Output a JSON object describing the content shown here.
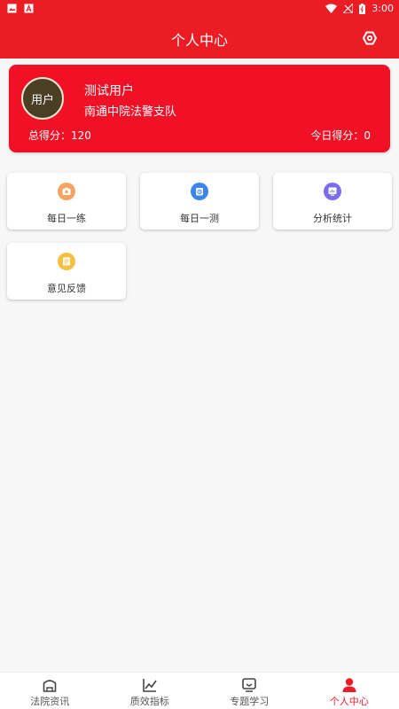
{
  "status_bar": {
    "time": "3:00"
  },
  "header": {
    "title": "个人中心"
  },
  "profile": {
    "avatar_text": "用户",
    "name": "测试用户",
    "department": "南通中院法警支队",
    "total_score": "总得分：120",
    "today_score": "今日得分：0"
  },
  "functions": [
    {
      "label": "每日一练",
      "icon": "camera-icon",
      "color": "#f5a463"
    },
    {
      "label": "每日一测",
      "icon": "alarm-icon",
      "color": "#3b86e8"
    },
    {
      "label": "分析统计",
      "icon": "monitor-icon",
      "color": "#7b6cea"
    },
    {
      "label": "意见反馈",
      "icon": "feedback-icon",
      "color": "#f7c140"
    }
  ],
  "bottom_nav": [
    {
      "label": "法院资讯",
      "icon": "court-icon"
    },
    {
      "label": "质效指标",
      "icon": "chart-line-icon"
    },
    {
      "label": "专题学习",
      "icon": "study-icon"
    },
    {
      "label": "个人中心",
      "icon": "user-icon",
      "active": true
    }
  ],
  "colors": {
    "primary": "#ec1c24",
    "card": "#f01126"
  }
}
